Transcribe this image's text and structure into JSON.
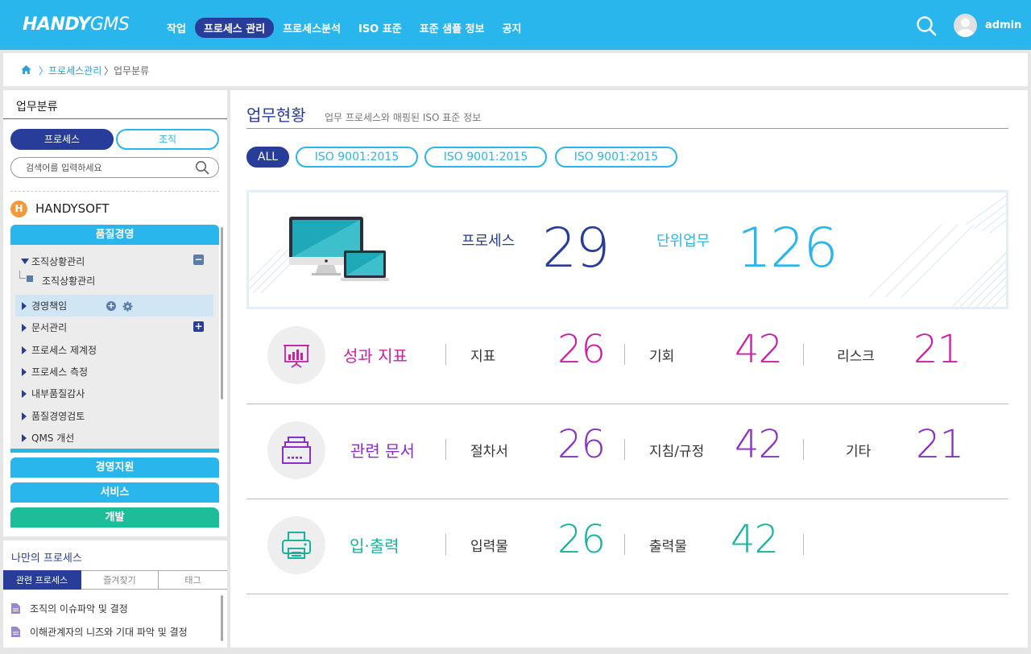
{
  "header": {
    "logo_bold": "HANDY",
    "logo_light": "GMS",
    "nav": [
      "작업",
      "프로세스 관리",
      "프로세스분석",
      "ISO 표준",
      "표준 샘플 정보",
      "공지"
    ],
    "user": "admin"
  },
  "breadcrumb": {
    "level1": "〉프로세스관리",
    "level2": "〉업무분류"
  },
  "left": {
    "title": "업무분류",
    "seg_process": "프로세스",
    "seg_org": "조직",
    "search_placeholder": "검색어를 입력하세요",
    "org_icon": "H",
    "org_name": "HANDYSOFT",
    "cat_quality": "품질경영",
    "tree": [
      "조직상황관리",
      "조직상황관리",
      "경영책임",
      "문서관리",
      "프로세스 제계정",
      "프로세스 측정",
      "내부품질감사",
      "품질경영검토",
      "QMS 개선"
    ],
    "cat_support": "경영지원",
    "cat_service": "서비스",
    "cat_dev": "개발"
  },
  "my": {
    "title": "나만의 프로세스",
    "tabs": [
      "관련 프로세스",
      "즐겨찾기",
      "태그"
    ],
    "items": [
      "조직의 이슈파악 및 결정",
      "이해관계자의 니즈와 기대 파악 및 결정"
    ]
  },
  "main": {
    "title": "업무현황",
    "subtitle": "업무 프로세스와 매핑된 ISO 표준 정보",
    "filters": [
      "ALL",
      "ISO 9001:2015",
      "ISO 9001:2015",
      "ISO 9001:2015"
    ],
    "hero": {
      "process_label": "프로세스",
      "process_count": "29",
      "unit_label": "단위업무",
      "unit_count": "126"
    },
    "rows": [
      {
        "title": "성과 지표",
        "color": "#cc1fa6",
        "items": [
          {
            "label": "지표",
            "value": "26"
          },
          {
            "label": "기회",
            "value": "42"
          },
          {
            "label": "리스크",
            "value": "21"
          }
        ]
      },
      {
        "title": "관련 문서",
        "color": "#8a2fc6",
        "items": [
          {
            "label": "절차서",
            "value": "26"
          },
          {
            "label": "지침/규정",
            "value": "42"
          },
          {
            "label": "기타",
            "value": "21"
          }
        ]
      },
      {
        "title": "입·출력",
        "color": "#17b39e",
        "items": [
          {
            "label": "입력물",
            "value": "26"
          },
          {
            "label": "출력물",
            "value": "42"
          }
        ]
      }
    ]
  },
  "colors": {
    "brand_blue": "#29b6ec",
    "navy": "#283c9a",
    "teal": "#1dbd9a",
    "magenta": "#cc1fa6",
    "purple": "#8a2fc6",
    "green": "#17b39e"
  }
}
